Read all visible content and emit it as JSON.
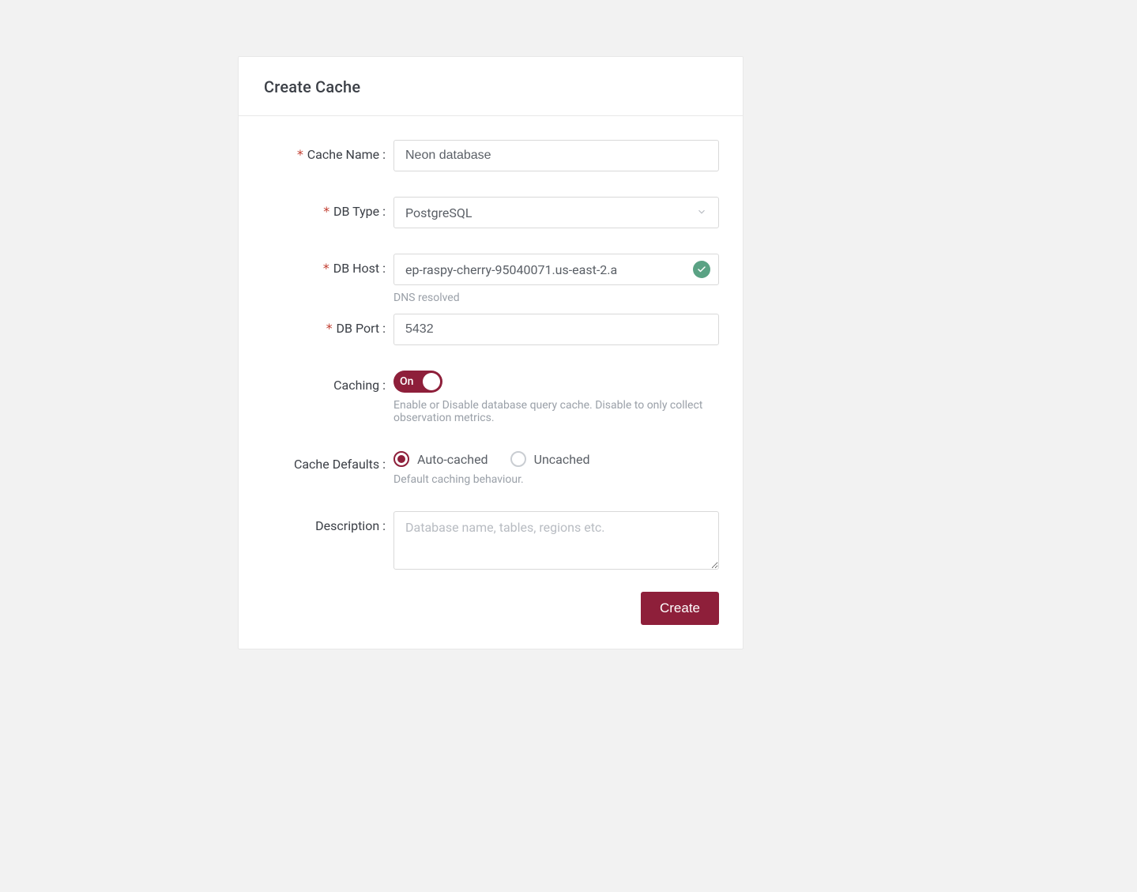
{
  "header": {
    "title": "Create Cache"
  },
  "colors": {
    "accent": "#8e1f3a",
    "success": "#5aa284"
  },
  "form": {
    "cache_name": {
      "label": "Cache Name :",
      "value": "Neon database"
    },
    "db_type": {
      "label": "DB Type :",
      "value": "PostgreSQL"
    },
    "db_host": {
      "label": "DB Host :",
      "value": "ep-raspy-cherry-95040071.us-east-2.a",
      "help": "DNS resolved"
    },
    "db_port": {
      "label": "DB Port :",
      "value": "5432"
    },
    "caching": {
      "label": "Caching :",
      "state": "On",
      "help": "Enable or Disable database query cache. Disable to only collect observation metrics."
    },
    "cache_defaults": {
      "label": "Cache Defaults :",
      "options": {
        "auto": "Auto-cached",
        "uncached": "Uncached"
      },
      "selected": "auto",
      "help": "Default caching behaviour."
    },
    "description": {
      "label": "Description :",
      "placeholder": "Database name, tables, regions etc."
    }
  },
  "actions": {
    "create": "Create"
  }
}
